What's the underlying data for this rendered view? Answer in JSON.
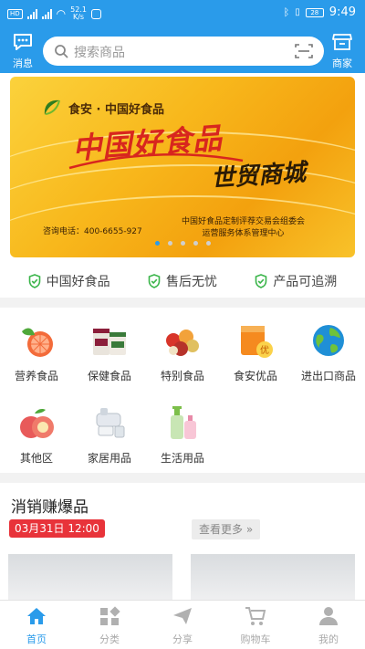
{
  "statusbar": {
    "network_speed": "52.1",
    "network_unit": "K/s",
    "battery": "28",
    "time": "9:49"
  },
  "header": {
    "message_label": "消息",
    "search_placeholder": "搜索商品",
    "shop_label": "商家"
  },
  "banner": {
    "brand": "食安 · 中国好食品",
    "title": "中国好食品",
    "subtitle": "世贸商城",
    "hotline": "咨询电话：400-6655-927",
    "organizer_line1": "中国好食品定制评荐交易会组委会",
    "organizer_line2": "运营服务体系管理中心",
    "slide_count": 5,
    "active_slide": 1
  },
  "guarantees": [
    {
      "label": "中国好食品",
      "icon": "shield-check-icon"
    },
    {
      "label": "售后无忧",
      "icon": "shield-check-icon"
    },
    {
      "label": "产品可追溯",
      "icon": "shield-check-icon"
    }
  ],
  "categories": [
    {
      "label": "营养食品",
      "icon": "grapefruit-icon"
    },
    {
      "label": "保健食品",
      "icon": "supplement-bottles-icon"
    },
    {
      "label": "特别食品",
      "icon": "fruit-basket-icon"
    },
    {
      "label": "食安优品",
      "icon": "premium-box-icon"
    },
    {
      "label": "进出口商品",
      "icon": "globe-icon"
    },
    {
      "label": "其他区",
      "icon": "peach-icon"
    },
    {
      "label": "家居用品",
      "icon": "water-purifier-icon"
    },
    {
      "label": "生活用品",
      "icon": "lotion-bottles-icon"
    }
  ],
  "flash_sale": {
    "title": "消销赚爆品",
    "time": "03月31日 12:00",
    "more_label": "查看更多 »"
  },
  "bottom_nav": [
    {
      "label": "首页",
      "icon": "home-icon",
      "active": true
    },
    {
      "label": "分类",
      "icon": "category-icon",
      "active": false
    },
    {
      "label": "分享",
      "icon": "share-icon",
      "active": false
    },
    {
      "label": "购物车",
      "icon": "cart-icon",
      "active": false
    },
    {
      "label": "我的",
      "icon": "user-icon",
      "active": false
    }
  ],
  "colors": {
    "primary": "#2a9bea",
    "sale_red": "#e8333a",
    "guarantee_green": "#3ab54a"
  }
}
